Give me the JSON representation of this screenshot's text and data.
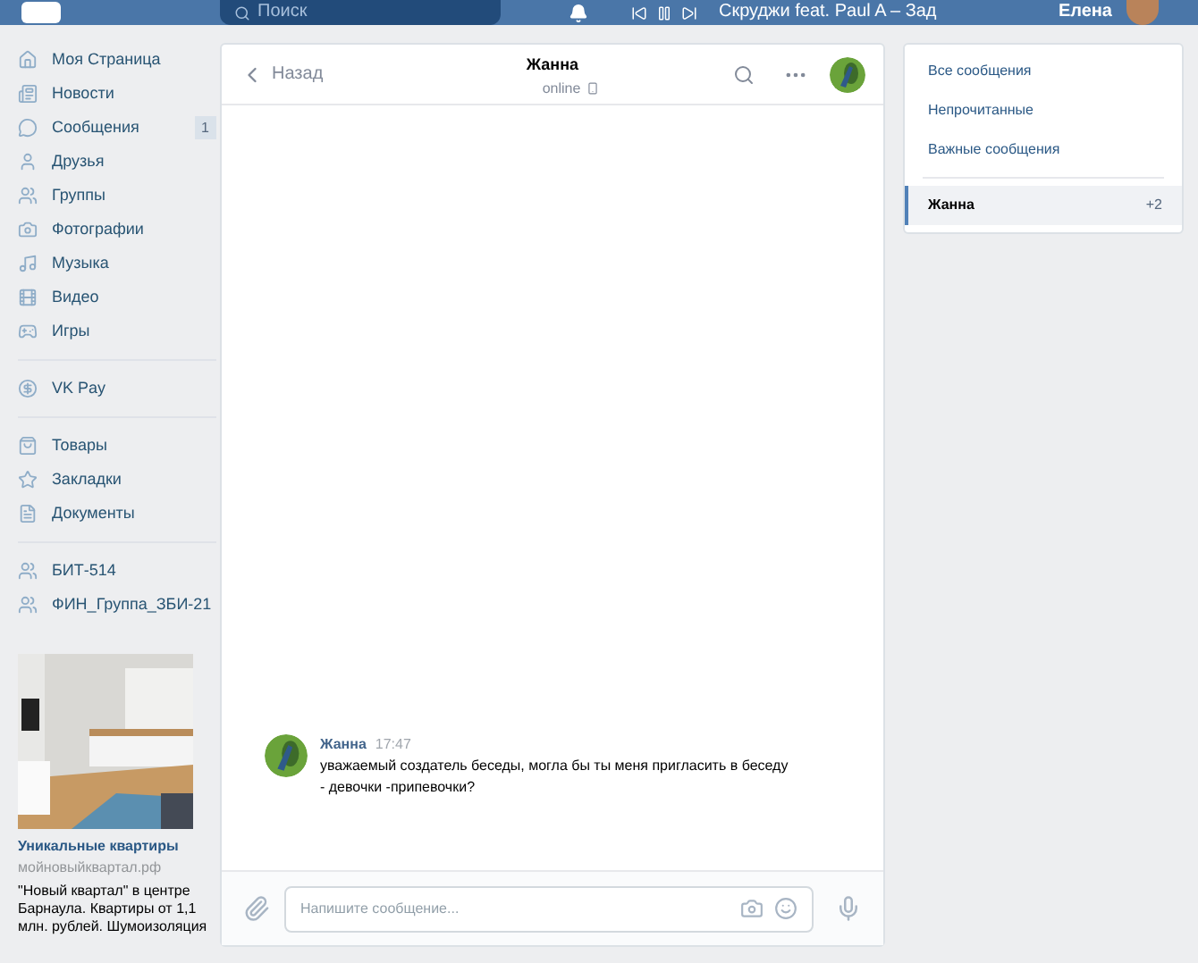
{
  "top_bar": {
    "search": {
      "placeholder": "Поиск"
    },
    "track": "Скруджи feat. Paul A – Зад",
    "user": "Елена"
  },
  "sidebar": {
    "groups": [
      [
        {
          "label": "Моя Страница"
        },
        {
          "label": "Новости"
        },
        {
          "label": "Сообщения",
          "badge": "1"
        },
        {
          "label": "Друзья"
        },
        {
          "label": "Группы"
        },
        {
          "label": "Фотографии"
        },
        {
          "label": "Музыка"
        },
        {
          "label": "Видео"
        },
        {
          "label": "Игры"
        }
      ],
      [
        {
          "label": "VK Pay"
        }
      ],
      [
        {
          "label": "Товары"
        },
        {
          "label": "Закладки"
        },
        {
          "label": "Документы"
        }
      ],
      [
        {
          "label": "БИТ-514"
        },
        {
          "label": "ФИН_Группа_ЗБИ-21"
        }
      ]
    ],
    "ad": {
      "title": "Уникальные квартиры",
      "domain": "мойновыйквартал.рф",
      "text": "\"Новый квартал\" в центре Барнаула. Квартиры от 1,1 млн. рублей. Шумоизоляция"
    }
  },
  "chat": {
    "back": "Назад",
    "name": "Жанна",
    "status": "online",
    "messages": [
      {
        "author": "Жанна",
        "time": "17:47",
        "text": "уважаемый создатель беседы, могла бы ты меня пригласить в беседу - девочки -припевочки?"
      }
    ],
    "input": {
      "placeholder": "Напишите сообщение..."
    }
  },
  "filters": [
    {
      "label": "Все сообщения"
    },
    {
      "label": "Непрочитанные"
    },
    {
      "label": "Важные сообщения"
    }
  ],
  "conversations": [
    {
      "name": "Жанна",
      "count": "+2",
      "selected": true
    }
  ]
}
